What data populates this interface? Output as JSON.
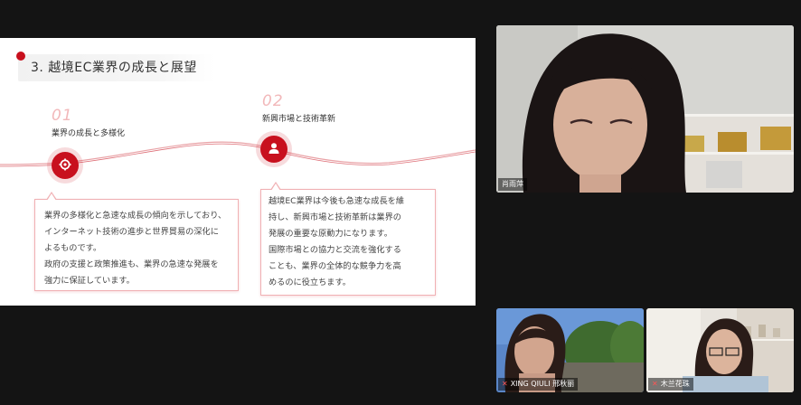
{
  "slide": {
    "title": "3.  越境EC業界の成長と展望",
    "points": [
      {
        "number": "01",
        "heading": "業界の成長と多様化",
        "icon": "gear-icon",
        "lines": [
          "業界の多様化と急速な成長の傾向を示しており、",
          "インターネット技術の進歩と世界貿易の深化に",
          "よるものです。",
          "政府の支援と政策推進も、業界の急速な発展を",
          "強力に保証しています。"
        ]
      },
      {
        "number": "02",
        "heading": "新興市場と技術革新",
        "icon": "person-icon",
        "lines": [
          "越境EC業界は今後も急速な成長を維",
          "持し、新興市場と技術革新は業界の",
          "発展の重要な原動力になります。",
          "国際市場との協力と交流を強化する",
          "ことも、業界の全体的な競争力を高",
          "めるのに役立ちます。"
        ]
      }
    ],
    "colors": {
      "accent": "#c8101e",
      "accent_light": "#f2b8ba"
    }
  },
  "participants": [
    {
      "name": "肖雨萍",
      "icon": "muted-mic-icon",
      "muted": false
    },
    {
      "name": "XING QIULI 邢秋丽",
      "icon": "muted-mic-icon",
      "muted": true
    },
    {
      "name": "木兰花珠",
      "icon": "muted-mic-icon",
      "muted": true
    }
  ]
}
